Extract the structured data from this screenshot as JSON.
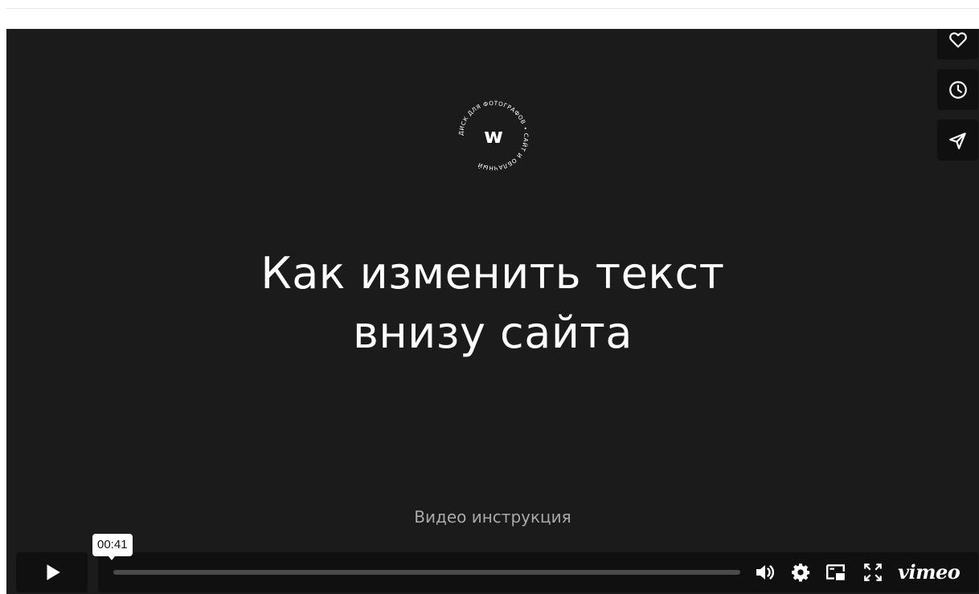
{
  "video": {
    "logo_letter": "w",
    "logo_ring_text": "ДИСК ДЛЯ ФОТОГРАФОВ • САЙТ И ОБЛАЧНЫЙ",
    "title_line1": "Как изменить текст",
    "title_line2": "внизу сайта",
    "subtitle": "Видео инструкция"
  },
  "side_actions": [
    {
      "name": "like",
      "icon": "heart-icon"
    },
    {
      "name": "watch-later",
      "icon": "clock-icon"
    },
    {
      "name": "share",
      "icon": "paper-plane-icon"
    }
  ],
  "controls": {
    "time_tooltip": "00:41",
    "progress": 0.0,
    "vimeo_label": "vimeo",
    "icons": [
      "play-icon",
      "volume-icon",
      "settings-icon",
      "picture-in-picture-icon",
      "fullscreen-icon"
    ]
  },
  "colors": {
    "background": "#1b1b1b",
    "control_bg": "#101010",
    "text": "#ffffff",
    "subtitle": "#a9a9a9"
  }
}
